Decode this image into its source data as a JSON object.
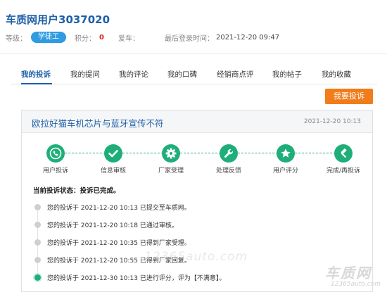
{
  "user": {
    "name": "车质网用户3037020",
    "level_label": "等级：",
    "level_badge": "学徒工",
    "points_label": "积分：",
    "points_value": "0",
    "car_label": "爱车：",
    "last_login_label": "最后登录时间：",
    "last_login_value": "2021-12-20 09:47"
  },
  "tabs": [
    {
      "label": "我的投诉",
      "active": true
    },
    {
      "label": "我的提问",
      "active": false
    },
    {
      "label": "我的评论",
      "active": false
    },
    {
      "label": "我的口碑",
      "active": false
    },
    {
      "label": "经销商点评",
      "active": false
    },
    {
      "label": "我的帖子",
      "active": false
    },
    {
      "label": "我的收藏",
      "active": false
    }
  ],
  "actions": {
    "complain_button": "我要投诉"
  },
  "complaint": {
    "title": "欧拉好猫车机芯片与蓝牙宣传不符",
    "date": "2021-12-20 10:13",
    "steps": [
      {
        "label": "用户投诉",
        "icon": "phone-icon"
      },
      {
        "label": "信息审核",
        "icon": "checkmark-icon"
      },
      {
        "label": "厂家受理",
        "icon": "gear-icon"
      },
      {
        "label": "处理反馈",
        "icon": "wrench-icon"
      },
      {
        "label": "用户评分",
        "icon": "star-icon"
      },
      {
        "label": "完成/再投诉",
        "icon": "hammer-icon"
      }
    ],
    "status_label": "当前投诉状态：投诉已完成。",
    "timeline": [
      {
        "text": "您的投诉于 2021-12-20 10:13 已提交至车质网。",
        "active": false
      },
      {
        "text": "您的投诉于 2021-12-20 10:18 已通过审核。",
        "active": false
      },
      {
        "text": "您的投诉于 2021-12-20 10:35 已得到厂家受理。",
        "active": false
      },
      {
        "text": "您的投诉于 2021-12-20 10:55 已得到厂家回复。",
        "active": false
      },
      {
        "text": "您的投诉于 2021-12-30 10:13 已进行评分，评为【不满意】。",
        "active": true
      }
    ]
  },
  "watermarks": {
    "center": "12365auto.com",
    "corner_main": "车质网",
    "corner_sub": "12365auto.com"
  },
  "colors": {
    "brand_blue": "#1e5fa8",
    "accent_orange": "#f07c1a",
    "step_green": "#1fae7a",
    "badge_blue": "#2f9be0",
    "points_red": "#e02020"
  }
}
